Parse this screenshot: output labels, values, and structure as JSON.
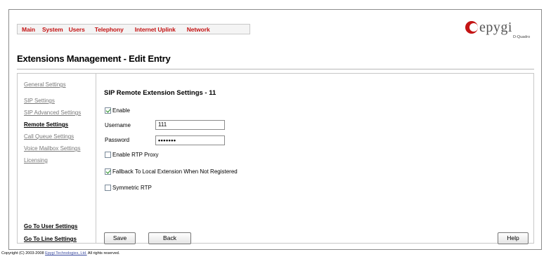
{
  "nav": {
    "items": [
      {
        "label": "Main"
      },
      {
        "label": "System"
      },
      {
        "label": "Users"
      },
      {
        "label": "Telephony"
      },
      {
        "label": "Internet Uplink"
      },
      {
        "label": "Network"
      }
    ]
  },
  "logo": {
    "text": "epygi",
    "subtitle": "D-Quadro"
  },
  "page": {
    "title": "Extensions Management - Edit Entry"
  },
  "sidebar": {
    "items": [
      {
        "label": "General Settings"
      },
      {
        "label": "SIP Settings"
      },
      {
        "label": "SIP Advanced Settings"
      },
      {
        "label": "Remote Settings"
      },
      {
        "label": "Call Queue Settings"
      },
      {
        "label": "Voice Mailbox Settings"
      },
      {
        "label": "Licensing"
      }
    ],
    "footer": [
      {
        "label": "Go To User Settings"
      },
      {
        "label": "Go To Line Settings"
      }
    ]
  },
  "form": {
    "heading": "SIP Remote Extension Settings - 11",
    "enable": {
      "label": "Enable",
      "checked": true
    },
    "username": {
      "label": "Username",
      "value": "111"
    },
    "password": {
      "label": "Password",
      "value": "•••••••"
    },
    "rtp_proxy": {
      "label": "Enable RTP Proxy",
      "checked": false
    },
    "fallback": {
      "label": "Fallback To Local Extension When Not Registered",
      "checked": true
    },
    "symmetric_rtp": {
      "label": "Symmetric RTP",
      "checked": false
    }
  },
  "buttons": {
    "save": "Save",
    "back": "Back",
    "help": "Help"
  },
  "footer": {
    "prefix": "Copyright (C) 2003-2008",
    "company": "Epygi Technologies, Ltd.",
    "suffix": "All rights reserved."
  },
  "colors": {
    "nav_link": "#c41414",
    "logo_red": "#c41414",
    "sidebar_link": "#7a7a7a",
    "check_green": "#1c8a1c"
  }
}
